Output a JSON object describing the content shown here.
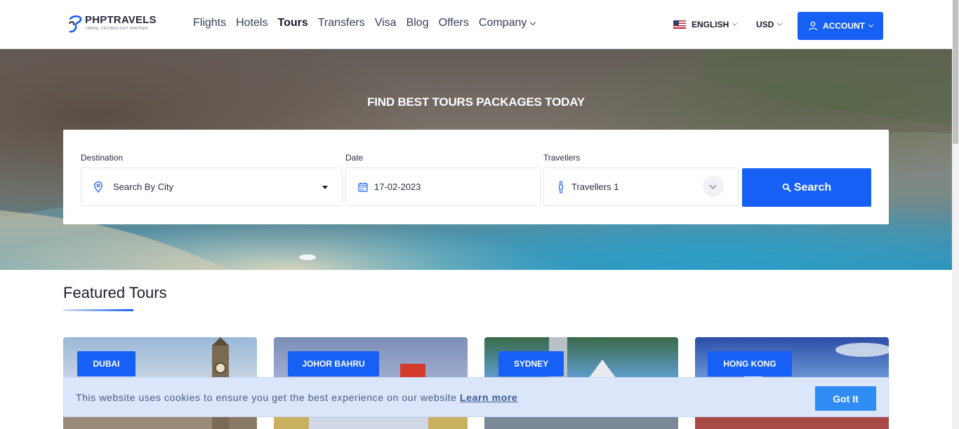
{
  "header": {
    "logo": {
      "name": "PHPTRAVELS",
      "tagline": "TRAVEL TECHNOLOGY PARTNER"
    },
    "nav": [
      {
        "label": "Flights"
      },
      {
        "label": "Hotels"
      },
      {
        "label": "Tours"
      },
      {
        "label": "Transfers"
      },
      {
        "label": "Visa"
      },
      {
        "label": "Blog"
      },
      {
        "label": "Offers"
      },
      {
        "label": "Company"
      }
    ],
    "active_nav": "Tours",
    "language": "ENGLISH",
    "currency": "USD",
    "account_label": "ACCOUNT"
  },
  "hero": {
    "title": "FIND BEST TOURS PACKAGES TODAY",
    "destination": {
      "label": "Destination",
      "value": "Search By City"
    },
    "date": {
      "label": "Date",
      "value": "17-02-2023"
    },
    "travellers": {
      "label": "Travellers",
      "value": "Travellers 1"
    },
    "search_label": "Search"
  },
  "featured": {
    "title": "Featured Tours",
    "tours": [
      {
        "city": "DUBAI"
      },
      {
        "city": "JOHOR BAHRU"
      },
      {
        "city": "SYDNEY"
      },
      {
        "city": "HONG KONG"
      }
    ]
  },
  "cookie": {
    "message": "This website uses cookies to ensure you get the best experience on our website",
    "link_label": "Learn more",
    "button_label": "Got It"
  },
  "colors": {
    "accent": "#1660f5",
    "cookie_bg": "#dbe6fb",
    "cookie_button": "#2f8cf5"
  }
}
